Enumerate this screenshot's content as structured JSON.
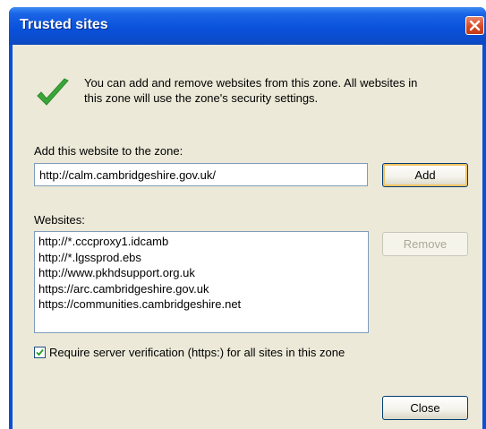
{
  "window": {
    "title": "Trusted sites"
  },
  "intro": {
    "line1": "You can add and remove websites from this zone. All websites in",
    "line2": "this zone will use the zone's security settings."
  },
  "add_section": {
    "label": "Add this website to the zone:",
    "url_value": "http://calm.cambridgeshire.gov.uk/",
    "add_button": "Add"
  },
  "websites_section": {
    "label": "Websites:",
    "items": [
      "http://*.cccproxy1.idcamb",
      "http://*.lgssprod.ebs",
      "http://www.pkhdsupport.org.uk",
      "https://arc.cambridgeshire.gov.uk",
      "https://communities.cambridgeshire.net"
    ],
    "remove_button": "Remove"
  },
  "verification": {
    "checked": true,
    "label": "Require server verification (https:) for all sites in this zone"
  },
  "footer": {
    "close_button": "Close"
  },
  "icons": {
    "title_close": "close-icon",
    "status": "checkmark-icon"
  },
  "colors": {
    "titlebar": "#0a52db",
    "client_bg": "#ece9d8",
    "close_red": "#d84a25",
    "check_green": "#3aa63a"
  }
}
